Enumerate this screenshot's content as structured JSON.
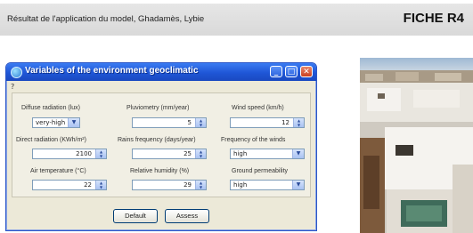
{
  "header": {
    "caption": "Résultat de l'application du model, Ghadamès, Lybie",
    "code": "FICHE R4"
  },
  "dialog": {
    "title": "Variables of the environment geoclimatic",
    "menu_help": "?",
    "fields": {
      "diffuse_radiation": {
        "label": "Diffuse radiation (lux)",
        "value": "very-high"
      },
      "pluviometry": {
        "label": "Pluviometry (mm/year)",
        "value": "5"
      },
      "wind_speed": {
        "label": "Wind speed (km/h)",
        "value": "12"
      },
      "direct_radiation": {
        "label": "Direct radiation (KWh/m²)",
        "value": "2100"
      },
      "rains_frequency": {
        "label": "Rains frequency (days/year)",
        "value": "25"
      },
      "winds_frequency": {
        "label": "Frequency of the winds",
        "value": "high"
      },
      "air_temperature": {
        "label": "Air temperature (°C)",
        "value": "22"
      },
      "relative_humidity": {
        "label": "Relative humidity (%)",
        "value": "29"
      },
      "ground_permeability": {
        "label": "Ground permeability",
        "value": "high"
      }
    },
    "buttons": {
      "default": "Default",
      "assess": "Assess"
    }
  },
  "icons": {
    "window": "globe-icon",
    "minimize": "minimize-icon",
    "maximize": "maximize-icon",
    "close": "close-icon",
    "dropdown": "chevron-down-icon",
    "spinner": "spinner-arrows-icon"
  },
  "colors": {
    "titlebar": "#1f56d6",
    "dialog_bg": "#ece9d8",
    "close": "#c9401f"
  }
}
